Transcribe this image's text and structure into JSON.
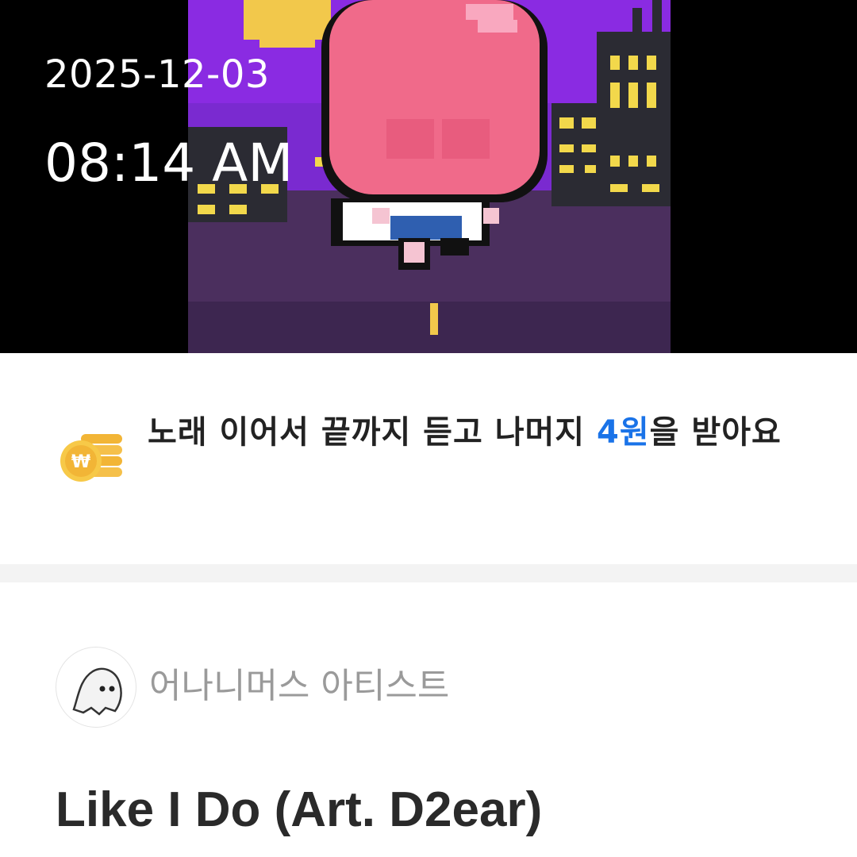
{
  "overlay": {
    "date": "2025-12-03",
    "time": "08:14 AM"
  },
  "reward": {
    "text_before": "노래 이어서 끝까지 듣고 나머지 ",
    "amount": "4원",
    "text_after": "을 받아요",
    "icon": "won-coin-stack-icon"
  },
  "track": {
    "artist": "어나니머스 아티스트",
    "artist_avatar_icon": "ghost-icon",
    "title": "Like I Do (Art. D2ear)"
  },
  "colors": {
    "accent": "#1a73e8",
    "art_sky": "#8a2be2",
    "art_hair": "#f06a8a"
  }
}
